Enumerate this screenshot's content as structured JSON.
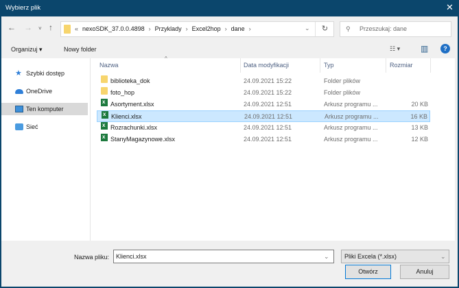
{
  "window": {
    "title": "Wybierz plik",
    "close_icon": "close-icon"
  },
  "nav": {
    "back": "←",
    "forward": "→",
    "recent": "˅",
    "up": "↑"
  },
  "address": {
    "prefix": "«",
    "crumbs": [
      "nexoSDK_37.0.0.4898",
      "Przyklady",
      "Excel2hop",
      "dane"
    ],
    "separator": "›",
    "dropdown": "⌄",
    "refresh": "↻"
  },
  "search": {
    "placeholder": "Przeszukaj: dane",
    "icon": "⚲"
  },
  "toolbar": {
    "organize": "Organizuj ▾",
    "new_folder": "Nowy folder",
    "view": "☷ ▾",
    "pane": "▥",
    "help": "?"
  },
  "sidebar": {
    "items": [
      {
        "label": "Szybki dostęp",
        "icon": "star-icon"
      },
      {
        "label": "OneDrive",
        "icon": "cloud-icon"
      },
      {
        "label": "Ten komputer",
        "icon": "computer-icon",
        "selected": true
      },
      {
        "label": "Sieć",
        "icon": "network-icon"
      }
    ]
  },
  "columns": {
    "name": "Nazwa",
    "date": "Data modyfikacji",
    "type": "Typ",
    "size": "Rozmiar",
    "sort_arrow": "^"
  },
  "files": [
    {
      "name": "biblioteka_dok",
      "date": "24.09.2021 15:22",
      "type": "Folder plików",
      "size": "",
      "kind": "folder"
    },
    {
      "name": "foto_hop",
      "date": "24.09.2021 15:22",
      "type": "Folder plików",
      "size": "",
      "kind": "folder"
    },
    {
      "name": "Asortyment.xlsx",
      "date": "24.09.2021 12:51",
      "type": "Arkusz programu ...",
      "size": "20 KB",
      "kind": "xlsx"
    },
    {
      "name": "Klienci.xlsx",
      "date": "24.09.2021 12:51",
      "type": "Arkusz programu ...",
      "size": "16 KB",
      "kind": "xlsx",
      "selected": true
    },
    {
      "name": "Rozrachunki.xlsx",
      "date": "24.09.2021 12:51",
      "type": "Arkusz programu ...",
      "size": "13 KB",
      "kind": "xlsx"
    },
    {
      "name": "StanyMagazynowe.xlsx",
      "date": "24.09.2021 12:51",
      "type": "Arkusz programu ...",
      "size": "12 KB",
      "kind": "xlsx"
    }
  ],
  "footer": {
    "filename_label": "Nazwa pliku:",
    "filename_value": "Klienci.xlsx",
    "filter": "Pliki Excela (*.xlsx)",
    "dropdown": "⌄",
    "open": "Otwórz",
    "cancel": "Anuluj"
  },
  "colors": {
    "titlebar": "#0b466c",
    "selection": "#cce8ff",
    "accent": "#0078d7"
  }
}
